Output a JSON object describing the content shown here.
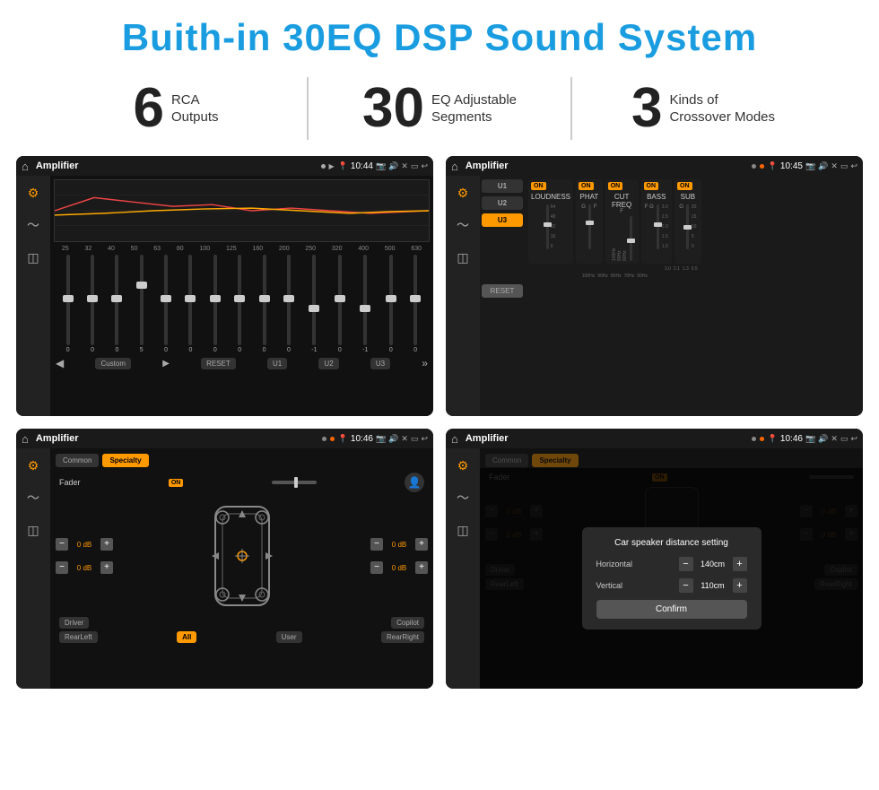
{
  "header": {
    "title": "Buith-in 30EQ DSP Sound System"
  },
  "stats": [
    {
      "number": "6",
      "label": "RCA\nOutputs"
    },
    {
      "number": "30",
      "label": "EQ Adjustable\nSegments"
    },
    {
      "number": "3",
      "label": "Kinds of\nCrossover Modes"
    }
  ],
  "screens": [
    {
      "id": "eq-screen",
      "status_bar": {
        "title": "Amplifier",
        "time": "10:44"
      },
      "type": "equalizer"
    },
    {
      "id": "crossover-screen",
      "status_bar": {
        "title": "Amplifier",
        "time": "10:45"
      },
      "type": "crossover"
    },
    {
      "id": "fader-screen",
      "status_bar": {
        "title": "Amplifier",
        "time": "10:46"
      },
      "type": "fader"
    },
    {
      "id": "distance-screen",
      "status_bar": {
        "title": "Amplifier",
        "time": "10:46"
      },
      "type": "distance",
      "dialog": {
        "title": "Car speaker distance setting",
        "horizontal_label": "Horizontal",
        "horizontal_value": "140cm",
        "vertical_label": "Vertical",
        "vertical_value": "110cm",
        "confirm_label": "Confirm"
      }
    }
  ],
  "eq": {
    "frequencies": [
      "25",
      "32",
      "40",
      "50",
      "63",
      "80",
      "100",
      "125",
      "160",
      "200",
      "250",
      "320",
      "400",
      "500",
      "630"
    ],
    "values": [
      "0",
      "0",
      "0",
      "5",
      "0",
      "0",
      "0",
      "0",
      "0",
      "0",
      "-1",
      "0",
      "-1",
      "0",
      "0"
    ],
    "preset": "Custom",
    "buttons": [
      "RESET",
      "U1",
      "U2",
      "U3"
    ]
  },
  "crossover": {
    "presets": [
      "U1",
      "U2",
      "U3"
    ],
    "channels": [
      {
        "label": "LOUDNESS",
        "on": true
      },
      {
        "label": "PHAT",
        "on": true
      },
      {
        "label": "CUT FREQ",
        "on": true
      },
      {
        "label": "BASS",
        "on": true
      },
      {
        "label": "SUB",
        "on": true
      }
    ]
  },
  "fader": {
    "tabs": [
      "Common",
      "Specialty"
    ],
    "active_tab": "Specialty",
    "fader_label": "Fader",
    "fader_on": true,
    "db_values": [
      "0 dB",
      "0 dB",
      "0 dB",
      "0 dB"
    ],
    "positions": [
      "Driver",
      "RearLeft",
      "All",
      "User",
      "RearRight",
      "Copilot"
    ]
  },
  "distance_dialog": {
    "title": "Car speaker distance setting",
    "horizontal_label": "Horizontal",
    "horizontal_value": "140cm",
    "vertical_label": "Vertical",
    "vertical_value": "110cm",
    "confirm_label": "Confirm"
  }
}
